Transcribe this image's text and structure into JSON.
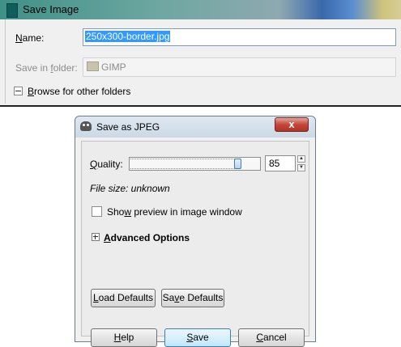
{
  "save_image": {
    "title": "Save Image",
    "name_label_accel": "N",
    "name_label_rest": "ame:",
    "name_value": "250x300-border.jpg",
    "save_in_label_pre": "Save in ",
    "save_in_label_accel": "f",
    "save_in_label_post": "older:",
    "folder_value": "GIMP",
    "browse_accel": "B",
    "browse_rest": "rowse for other folders"
  },
  "jpeg": {
    "title": "Save as JPEG",
    "close_glyph": "x",
    "quality_label_accel": "Q",
    "quality_label_rest": "uality:",
    "quality_value": "85",
    "quality_fraction": 0.85,
    "spin_up": "▲",
    "spin_down": "▼",
    "file_size": "File size: unknown",
    "preview_pre": "Sho",
    "preview_accel": "w",
    "preview_post": " preview in image window",
    "advanced_accel": "A",
    "advanced_rest": "dvanced Options",
    "load_accel": "L",
    "load_rest": "oad Defaults",
    "save_def_pre": "Sa",
    "save_def_accel": "v",
    "save_def_post": "e Defaults",
    "help_accel": "H",
    "help_rest": "elp",
    "save_accel": "S",
    "save_rest": "ave",
    "cancel_accel": "C",
    "cancel_rest": "ancel"
  }
}
